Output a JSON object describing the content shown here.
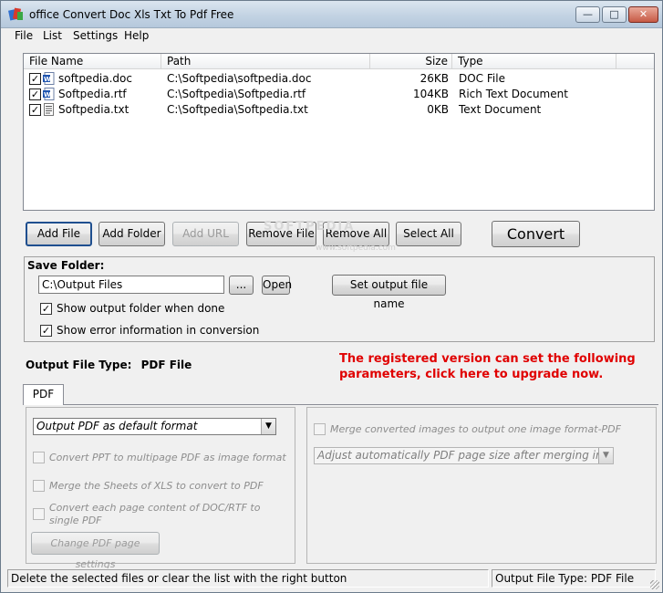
{
  "window": {
    "title": "office Convert Doc Xls Txt To Pdf Free",
    "minimize_glyph": "—",
    "maximize_glyph": "□",
    "close_glyph": "✕"
  },
  "menu": [
    "File",
    "List",
    "Settings",
    "Help"
  ],
  "file_list": {
    "columns": [
      "File Name",
      "Path",
      "Size",
      "Type"
    ],
    "rows": [
      {
        "checked": true,
        "icon": "word-doc-icon",
        "name": "softpedia.doc",
        "path": "C:\\Softpedia\\softpedia.doc",
        "size": "26KB",
        "type": "DOC File"
      },
      {
        "checked": true,
        "icon": "word-doc-icon",
        "name": "Softpedia.rtf",
        "path": "C:\\Softpedia\\Softpedia.rtf",
        "size": "104KB",
        "type": "Rich Text Document"
      },
      {
        "checked": true,
        "icon": "text-file-icon",
        "name": "Softpedia.txt",
        "path": "C:\\Softpedia\\Softpedia.txt",
        "size": "0KB",
        "type": "Text Document"
      }
    ]
  },
  "toolbar": {
    "add_file": "Add File",
    "add_folder": "Add Folder",
    "add_url": "Add URL",
    "remove_file": "Remove File",
    "remove_all": "Remove All",
    "select_all": "Select All",
    "convert": "Convert"
  },
  "watermark": {
    "text": "SOFTPEDIA",
    "url": "www.softpedia.com"
  },
  "save_folder": {
    "label": "Save Folder:",
    "path": "C:\\Output Files",
    "browse": "...",
    "open": "Open",
    "set_name": "Set output file name",
    "show_output_folder": {
      "label": "Show output folder when done",
      "checked": true
    },
    "show_error_info": {
      "label": "Show error information in conversion",
      "checked": true
    }
  },
  "output_type": {
    "label": "Output File Type:",
    "value": "PDF File"
  },
  "promo": "The registered version can set the following parameters, click here to upgrade now.",
  "tabs": [
    "PDF"
  ],
  "pdf_options": {
    "format_select": "Output PDF as default format",
    "ppt_multipage": "Convert PPT to multipage PDF as image format",
    "merge_xls": "Merge the Sheets of XLS to convert to PDF",
    "each_page": "Convert each page content of DOC/RTF to single PDF",
    "page_settings": "Change PDF page settings",
    "merge_images": "Merge converted images to output one image format-PDF",
    "adjust_size": "Adjust automatically PDF page size after merging images to PDF"
  },
  "status": {
    "hint": "Delete the selected files or clear the list with the right button",
    "output_type": "Output File Type:  PDF File"
  },
  "colors": {
    "promo_red": "#e00000",
    "title_bar": "#c3d3e3",
    "close_button": "#c75a45"
  }
}
